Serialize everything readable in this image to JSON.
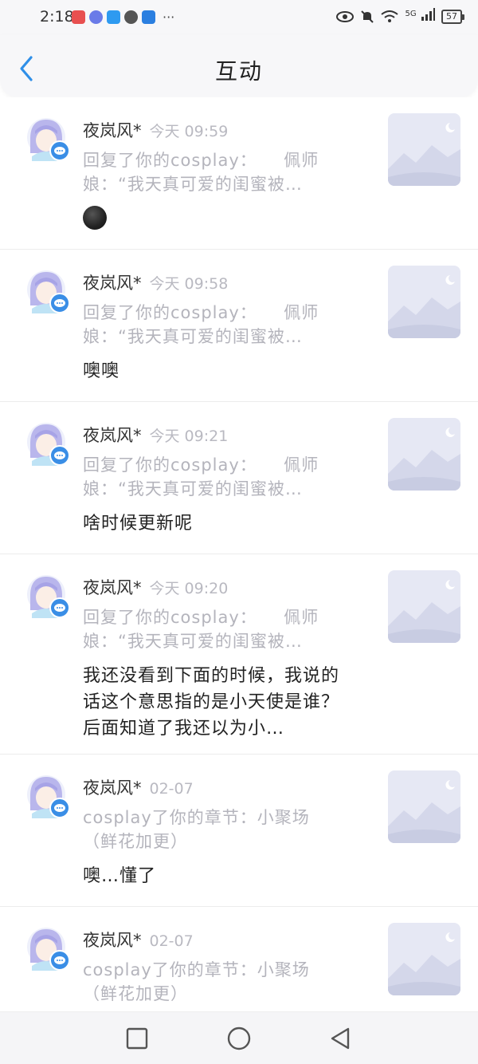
{
  "status": {
    "time": "2:18",
    "more": "···",
    "network": "5G",
    "battery": "57"
  },
  "header": {
    "title": "互动"
  },
  "items": [
    {
      "name": "夜岚风*",
      "time": "今天 09:59",
      "quote_line1": "回复了你的cosplay：　　佩师",
      "quote_line2": "娘：“我天真可爱的闺蜜被…",
      "content": "",
      "content_emoji": "dark-face-emoji"
    },
    {
      "name": "夜岚风*",
      "time": "今天 09:58",
      "quote_line1": "回复了你的cosplay：　　佩师",
      "quote_line2": "娘：“我天真可爱的闺蜜被…",
      "content": "噢噢"
    },
    {
      "name": "夜岚风*",
      "time": "今天 09:21",
      "quote_line1": "回复了你的cosplay：　　佩师",
      "quote_line2": "娘：“我天真可爱的闺蜜被…",
      "content": "啥时候更新呢"
    },
    {
      "name": "夜岚风*",
      "time": "今天 09:20",
      "quote_line1": "回复了你的cosplay：　　佩师",
      "quote_line2": "娘：“我天真可爱的闺蜜被…",
      "content": "我还没看到下面的时候，我说的话这个意思指的是小天使是谁？后面知道了我还以为小…"
    },
    {
      "name": "夜岚风*",
      "time": "02-07",
      "quote_line1": "cosplay了你的章节：小聚场",
      "quote_line2": "（鲜花加更）",
      "content": "噢…懂了"
    },
    {
      "name": "夜岚风*",
      "time": "02-07",
      "quote_line1": "cosplay了你的章节：小聚场",
      "quote_line2": "（鲜花加更）",
      "content": ""
    }
  ],
  "colors": {
    "accent": "#2f8fe8",
    "badge": "#3a8ee6",
    "muted_text": "#b4b4bc"
  }
}
